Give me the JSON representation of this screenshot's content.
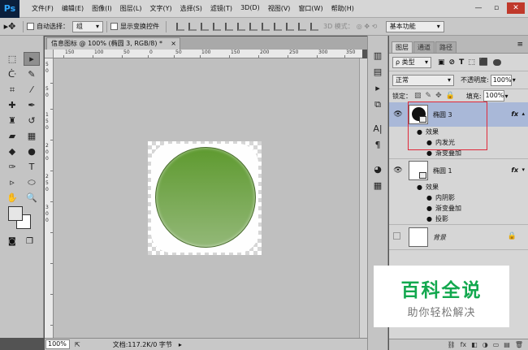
{
  "app": {
    "logo": "Ps"
  },
  "menubar": {
    "items": [
      "文件(F)",
      "编辑(E)",
      "图像(I)",
      "图层(L)",
      "文字(Y)",
      "选择(S)",
      "滤镜(T)",
      "3D(D)",
      "视图(V)",
      "窗口(W)",
      "帮助(H)"
    ],
    "window_controls": [
      "—",
      "▫",
      "✕"
    ]
  },
  "options": {
    "auto_select_label": "自动选择：",
    "auto_select_value": "组",
    "show_transform_label": "显示变换控件",
    "mode_3d_label": "3D 模式：",
    "workspace_value": "基本功能"
  },
  "document": {
    "tab_title": "信息图标 @ 100% (椭圆 3, RGB/8) *",
    "close": "×",
    "ruler_top_labels": [
      "150",
      "100",
      "50",
      "0",
      "50",
      "100",
      "150",
      "200",
      "250",
      "300",
      "350"
    ],
    "ruler_left_labels": [
      "5",
      "0",
      "5",
      "0",
      "1",
      "5",
      "0",
      "2",
      "0",
      "0",
      "2",
      "5",
      "0",
      "3",
      "0",
      "0"
    ],
    "zoom": "100%",
    "status": "文档:117.2K/0 字节"
  },
  "layers_panel": {
    "tabs": [
      "图层",
      "通道",
      "路径"
    ],
    "filter_value": "ρ 类型",
    "filter_icons": [
      "▣",
      "⊘",
      "T",
      "⬚",
      "⬛"
    ],
    "blend_mode": "正常",
    "opacity_label": "不透明度:",
    "opacity_value": "100%",
    "lock_label": "锁定：",
    "lock_icons": [
      "▨",
      "✎",
      "✥",
      "🔒"
    ],
    "fill_label": "填充:",
    "fill_value": "100%",
    "layers": [
      {
        "name": "椭圆 3",
        "fx": "fx",
        "effects_label": "效果",
        "effects": [
          "内发光",
          "渐变叠加"
        ]
      },
      {
        "name": "椭圆 1",
        "fx": "fx",
        "effects_label": "效果",
        "effects": [
          "内阴影",
          "渐变叠加",
          "投影"
        ]
      },
      {
        "name": "背景",
        "lock": "🔒"
      }
    ],
    "bottom_icons": [
      "⛓",
      "fx",
      "◧",
      "◑",
      "▭",
      "▤",
      "🗑"
    ]
  },
  "watermark": {
    "title": "百科全说",
    "subtitle": "助你轻松解决"
  },
  "colors": {
    "accent_selected_layer": "#a9b8d8",
    "highlight_box": "#e0293a",
    "watermark_green": "#12a84e"
  }
}
